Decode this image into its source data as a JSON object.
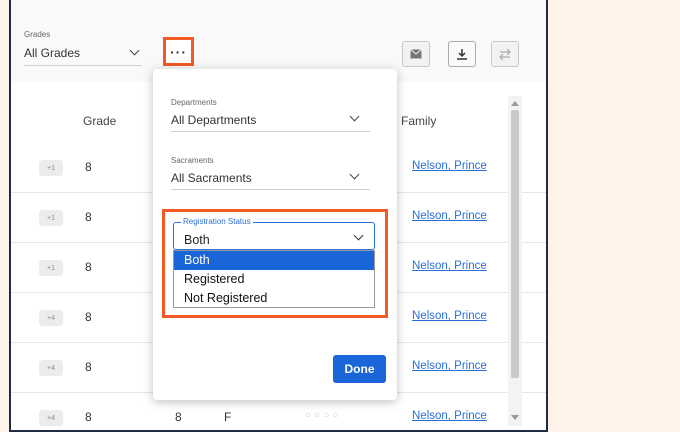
{
  "filters": {
    "grades_label": "Grades",
    "grades_value": "All Grades",
    "more_label": "···"
  },
  "table": {
    "headers": {
      "grade": "Grade",
      "family": "Family"
    },
    "rows": [
      {
        "badge": "+1",
        "grade": "8",
        "family": "Nelson, Prince"
      },
      {
        "badge": "+1",
        "grade": "8",
        "family": "Nelson, Prince"
      },
      {
        "badge": "+1",
        "grade": "8",
        "family": "Nelson, Prince"
      },
      {
        "badge": "+4",
        "grade": "8",
        "family": "Nelson, Prince"
      },
      {
        "badge": "+4",
        "grade": "8",
        "family": "Nelson, Prince"
      },
      {
        "badge": "+4",
        "grade": "8",
        "grade2": "8",
        "gender": "F",
        "family": "Nelson, Prince"
      }
    ]
  },
  "panel": {
    "departments_label": "Departments",
    "departments_value": "All Departments",
    "sacraments_label": "Sacraments",
    "sacraments_value": "All Sacraments",
    "registration_label": "Registration Status",
    "registration_value": "Both",
    "registration_options": [
      "Both",
      "Registered",
      "Not Registered"
    ],
    "done_label": "Done"
  },
  "colors": {
    "accent": "#1a66d9",
    "highlight": "#f15a24",
    "link": "#2a6fd6",
    "page_bg": "#fdf3e8"
  },
  "icons": [
    "chevron-down-icon",
    "more-icon",
    "email-icon",
    "download-icon",
    "swap-icon"
  ]
}
